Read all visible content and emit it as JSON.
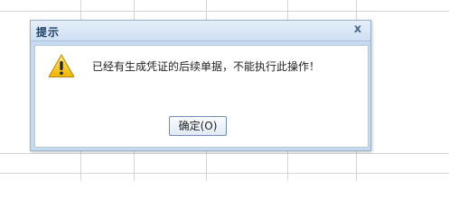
{
  "dialog": {
    "title": "提示",
    "close_glyph": "x",
    "message": "已经有生成凭证的后续单据，不能执行此操作！",
    "icon": "warning-icon",
    "ok_label": "确定(O)"
  },
  "colors": {
    "title_bar_start": "#e6effa",
    "title_bar_end": "#cedff2",
    "dialog_frame": "#c8daee",
    "grid_line": "#d4d4d4",
    "warning_yellow": "#f5c518"
  }
}
